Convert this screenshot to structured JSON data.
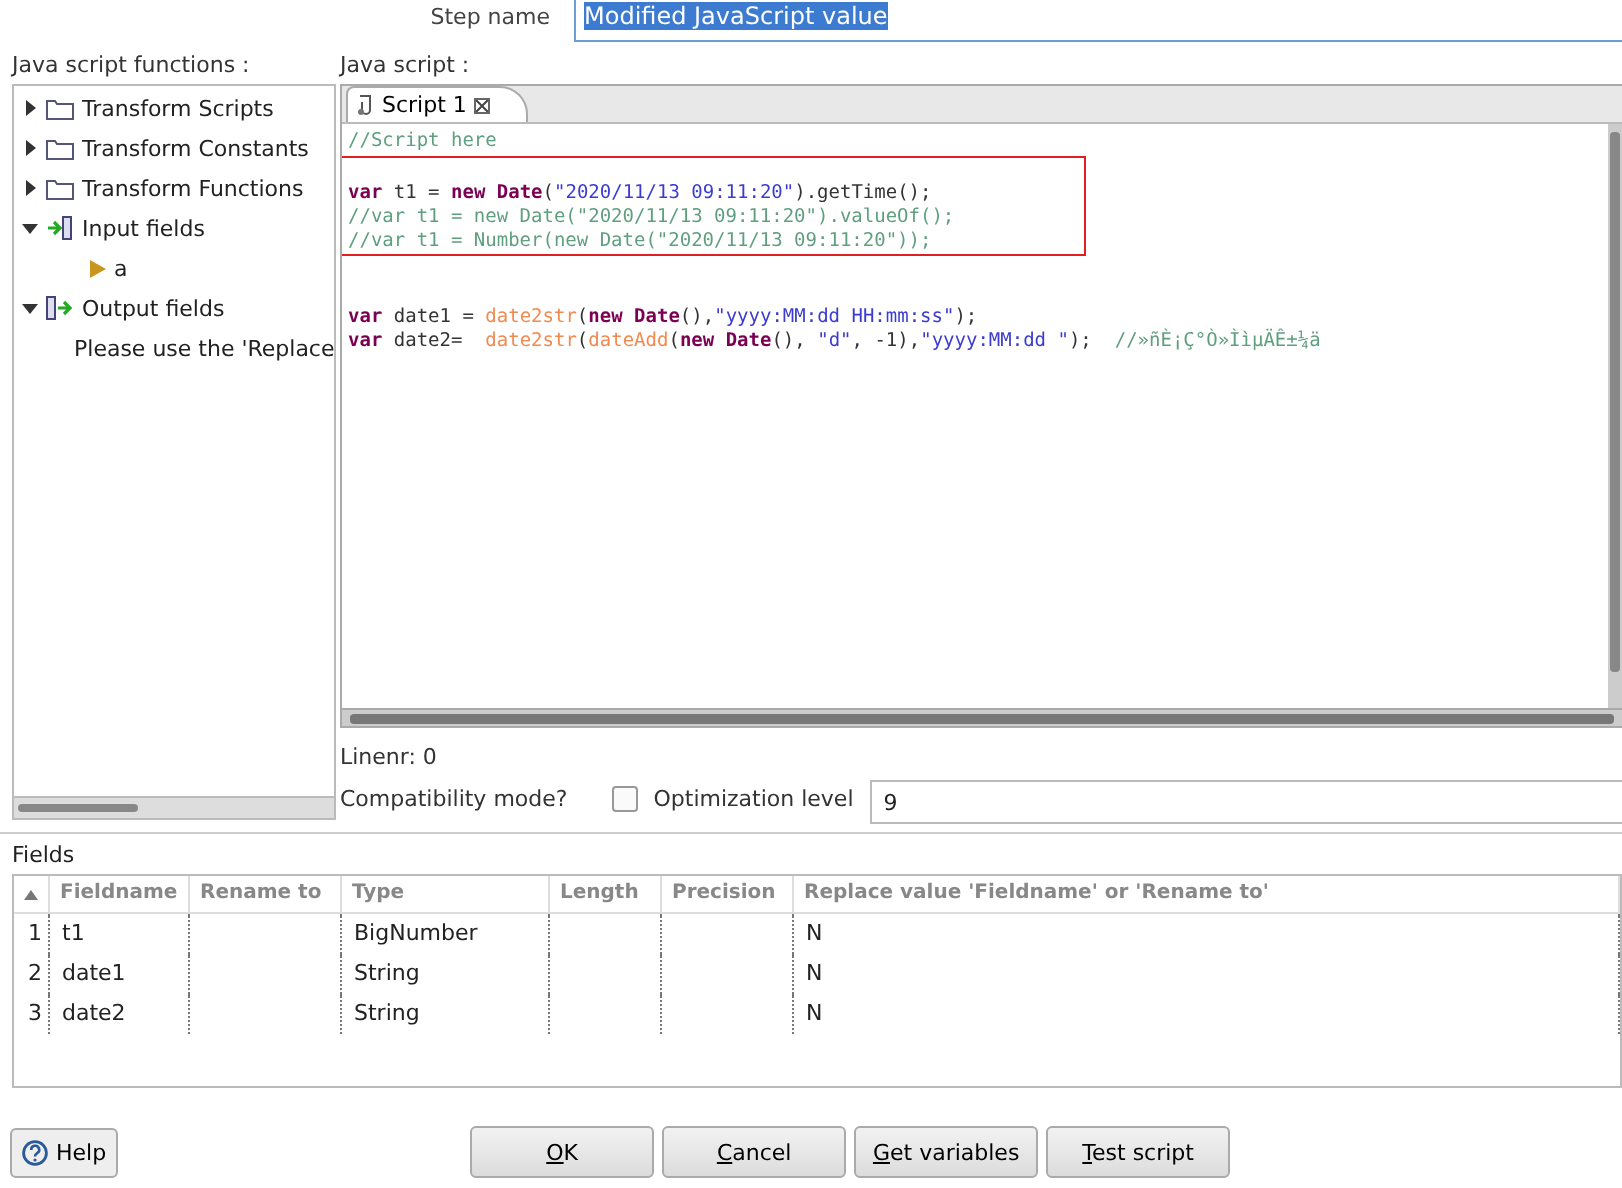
{
  "step_name": {
    "label": "Step name",
    "value": "Modified JavaScript value"
  },
  "functions_panel": {
    "label": "Java script functions :",
    "tree": [
      {
        "label": "Transform Scripts",
        "kind": "folder",
        "expanded": false
      },
      {
        "label": "Transform Constants",
        "kind": "folder",
        "expanded": false
      },
      {
        "label": "Transform Functions",
        "kind": "folder",
        "expanded": false
      },
      {
        "label": "Input fields",
        "kind": "input",
        "expanded": true,
        "children": [
          {
            "label": "a",
            "kind": "field"
          }
        ]
      },
      {
        "label": "Output fields",
        "kind": "output",
        "expanded": true,
        "children": [
          {
            "label": "Please use the 'Replace",
            "kind": "note"
          }
        ]
      }
    ]
  },
  "editor": {
    "label": "Java script :",
    "tabs": [
      {
        "label": "Script 1",
        "selected": true
      }
    ],
    "blocks": [
      {
        "highlighted": false,
        "lines": [
          [
            {
              "kind": "comment",
              "text": "//Script here"
            }
          ]
        ]
      },
      {
        "highlighted": true,
        "lines": [
          [
            {
              "kind": "keyword",
              "text": "var"
            },
            {
              "kind": "plain",
              "text": " t1 = "
            },
            {
              "kind": "keyword",
              "text": "new Date"
            },
            {
              "kind": "plain",
              "text": "("
            },
            {
              "kind": "string",
              "text": "\"2020/11/13 09:11:20\""
            },
            {
              "kind": "plain",
              "text": ").getTime();"
            }
          ],
          [
            {
              "kind": "comment",
              "text": "//var t1 = new Date(\"2020/11/13 09:11:20\").valueOf();"
            }
          ],
          [
            {
              "kind": "comment",
              "text": "//var t1 = Number(new Date(\"2020/11/13 09:11:20\"));"
            }
          ]
        ]
      },
      {
        "highlighted": false,
        "lines": [
          [
            {
              "kind": "keyword",
              "text": "var"
            },
            {
              "kind": "plain",
              "text": " date1 = "
            },
            {
              "kind": "func",
              "text": "date2str"
            },
            {
              "kind": "plain",
              "text": "("
            },
            {
              "kind": "keyword",
              "text": "new Date"
            },
            {
              "kind": "plain",
              "text": "(),"
            },
            {
              "kind": "string",
              "text": "\"yyyy:MM:dd HH:mm:ss\""
            },
            {
              "kind": "plain",
              "text": ");"
            }
          ],
          [
            {
              "kind": "keyword",
              "text": "var"
            },
            {
              "kind": "plain",
              "text": " date2=  "
            },
            {
              "kind": "func",
              "text": "date2str"
            },
            {
              "kind": "plain",
              "text": "("
            },
            {
              "kind": "func",
              "text": "dateAdd"
            },
            {
              "kind": "plain",
              "text": "("
            },
            {
              "kind": "keyword",
              "text": "new Date"
            },
            {
              "kind": "plain",
              "text": "(), "
            },
            {
              "kind": "string",
              "text": "\"d\""
            },
            {
              "kind": "plain",
              "text": ", -1),"
            },
            {
              "kind": "string",
              "text": "\"yyyy:MM:dd \""
            },
            {
              "kind": "plain",
              "text": ");  "
            },
            {
              "kind": "comment",
              "text": "//»ñÈ¡Ç°Ò»ÌìµÄÊ±¼ä"
            }
          ]
        ]
      }
    ],
    "line_number": "Linenr: 0"
  },
  "compatibility": {
    "label": "Compatibility mode?",
    "checked": false
  },
  "optimization": {
    "label": "Optimization level",
    "value": "9"
  },
  "fields": {
    "label": "Fields",
    "columns": [
      "Fieldname",
      "Rename to",
      "Type",
      "Length",
      "Precision",
      "Replace value 'Fieldname' or 'Rename to'"
    ],
    "rows": [
      {
        "index": "1",
        "fieldname": "t1",
        "type": "BigNumber",
        "replace": "N"
      },
      {
        "index": "2",
        "fieldname": "date1",
        "type": "String",
        "replace": "N"
      },
      {
        "index": "3",
        "fieldname": "date2",
        "type": "String",
        "replace": "N"
      }
    ]
  },
  "buttons": {
    "help": "Help",
    "actions": [
      "OK",
      "Cancel",
      "Get variables",
      "Test script"
    ]
  }
}
